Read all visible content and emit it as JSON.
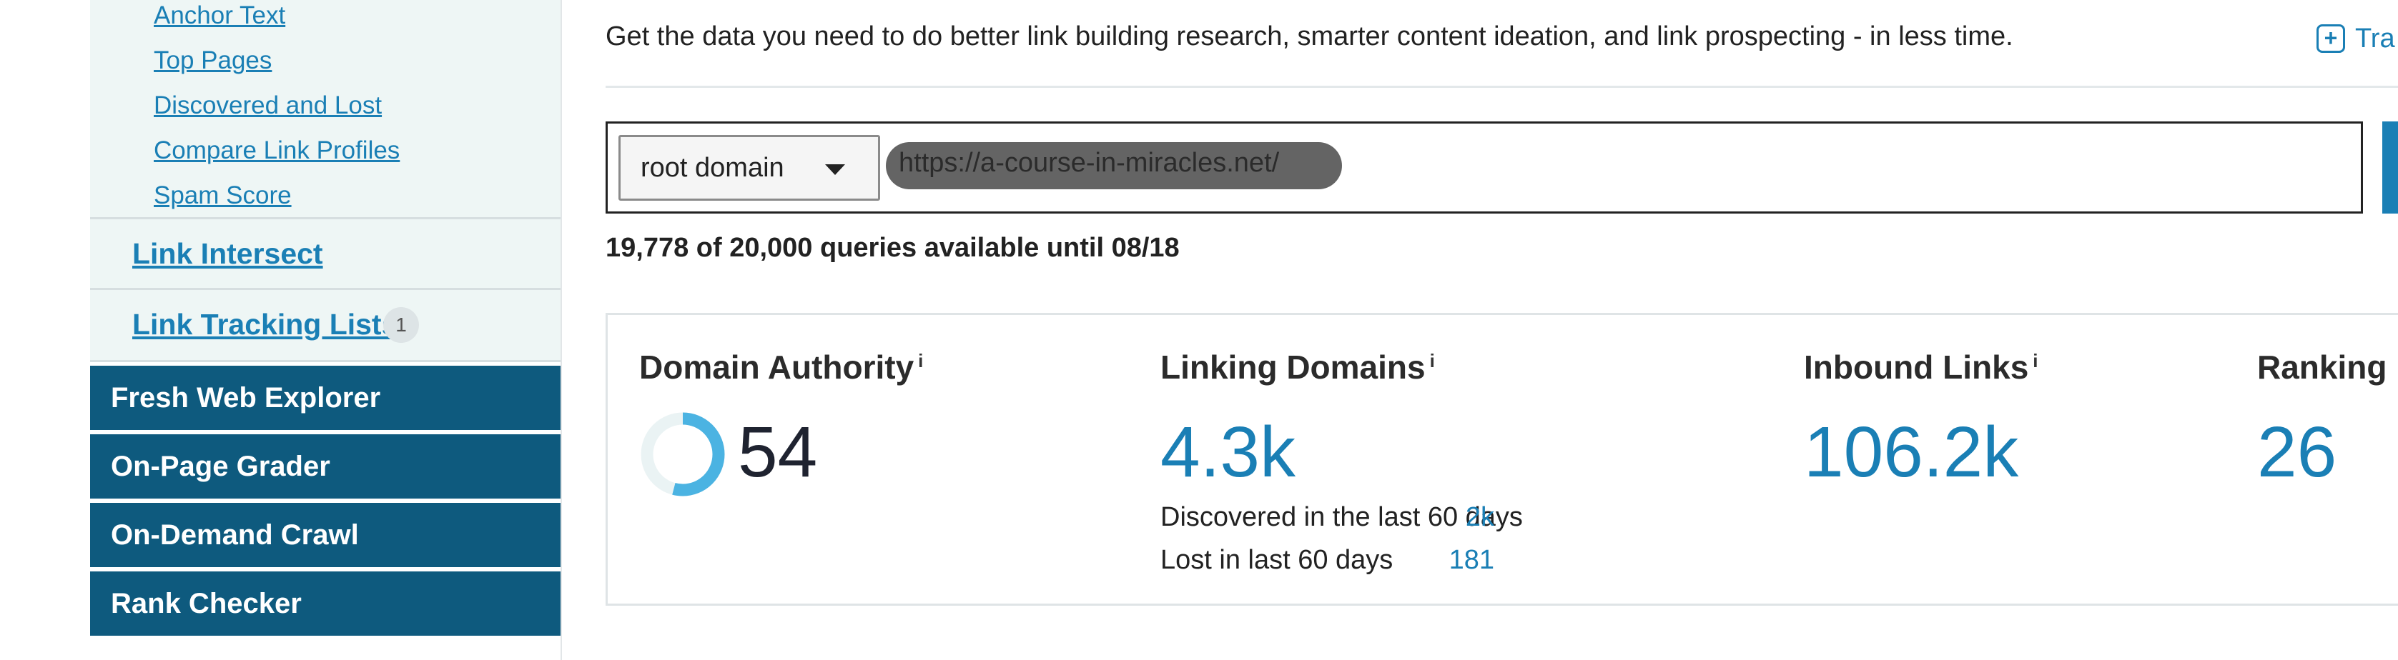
{
  "sidebar": {
    "sub_items": [
      {
        "label": "Anchor Text"
      },
      {
        "label": "Top Pages"
      },
      {
        "label": "Discovered and Lost"
      },
      {
        "label": "Compare Link Profiles"
      },
      {
        "label": "Spam Score"
      }
    ],
    "sections": [
      {
        "label": "Link Intersect"
      },
      {
        "label": "Link Tracking Lists",
        "badge": "1"
      }
    ],
    "nav": [
      {
        "label": "Fresh Web Explorer"
      },
      {
        "label": "On-Page Grader"
      },
      {
        "label": "On-Demand Crawl"
      },
      {
        "label": "Rank Checker"
      }
    ]
  },
  "main": {
    "intro": "Get the data you need to do better link building research, smarter content ideation, and link prospecting - in less time.",
    "track_link": "Tra",
    "search": {
      "scope": "root domain",
      "url": "https://a-course-in-miracles.net/"
    },
    "quota": "19,778 of 20,000 queries available until 08/18",
    "metrics": {
      "info_icon": "i",
      "domain_authority": {
        "title": "Domain Authority",
        "value": "54",
        "score_fraction": 0.54
      },
      "linking_domains": {
        "title": "Linking Domains",
        "value": "4.3k",
        "discovered_label": "Discovered in the last 60 days",
        "discovered_value": "2k",
        "lost_label": "Lost in last 60 days",
        "lost_value": "181"
      },
      "inbound_links": {
        "title": "Inbound Links",
        "value": "106.2k"
      },
      "ranking": {
        "title": "Ranking",
        "value": "26"
      }
    }
  },
  "colors": {
    "accent": "#1a7fb5",
    "nav_bg": "#0e5a7e",
    "sidebar_bg": "#eef6f5",
    "da_ring": "#4bb3e2"
  }
}
